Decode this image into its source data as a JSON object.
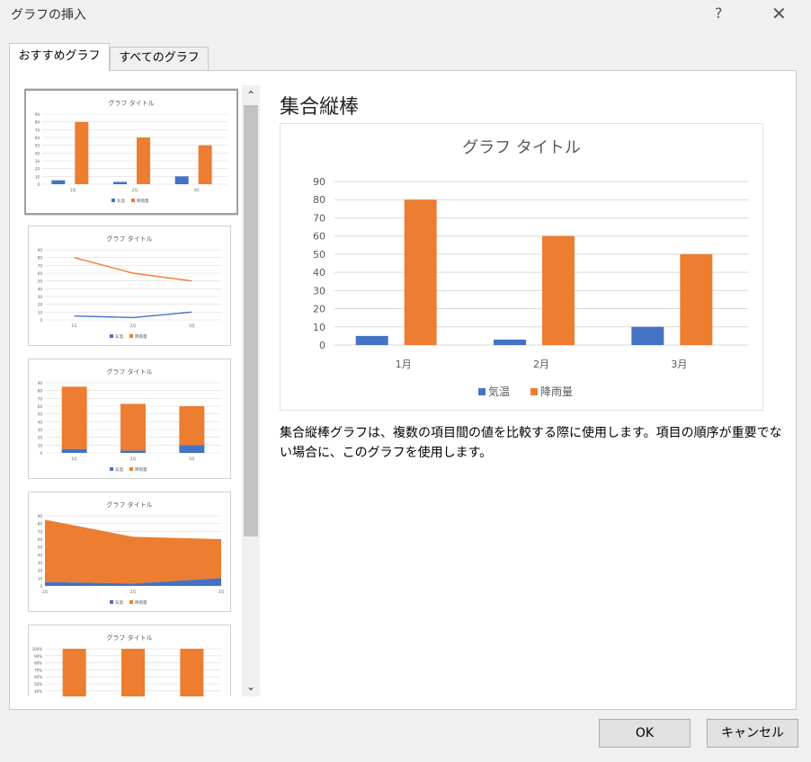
{
  "window": {
    "title": "グラフの挿入",
    "help": "?",
    "close": "✕"
  },
  "tabs": [
    {
      "label": "おすすめグラフ"
    },
    {
      "label": "すべてのグラフ"
    }
  ],
  "selected_chart_name": "集合縦棒",
  "description": "集合縦棒グラフは、複数の項目間の値を比較する際に使用します。項目の順序が重要でない場合に、このグラフを使用します。",
  "buttons": {
    "ok": "OK",
    "cancel": "キャンセル"
  },
  "scroll": {
    "up": "⌃",
    "down": "⌄"
  },
  "colors": {
    "series1": "#4472c4",
    "series2": "#ed7d31",
    "grid": "#d9d9d9",
    "axis_text": "#595959"
  },
  "thumb_options": [
    {
      "type": "clustered-column"
    },
    {
      "type": "line"
    },
    {
      "type": "stacked-column"
    },
    {
      "type": "stacked-area"
    },
    {
      "type": "100%-stacked-column"
    }
  ],
  "chart_data": {
    "type": "bar",
    "title": "グラフ タイトル",
    "categories": [
      "1月",
      "2月",
      "3月"
    ],
    "series": [
      {
        "name": "気温",
        "values": [
          5,
          3,
          10
        ]
      },
      {
        "name": "降雨量",
        "values": [
          80,
          60,
          50
        ]
      }
    ],
    "ylim": [
      0,
      90
    ],
    "yticks": [
      0,
      10,
      20,
      30,
      40,
      50,
      60,
      70,
      80,
      90
    ],
    "grid": true,
    "legend": "bottom",
    "xlabel": "",
    "ylabel": ""
  }
}
